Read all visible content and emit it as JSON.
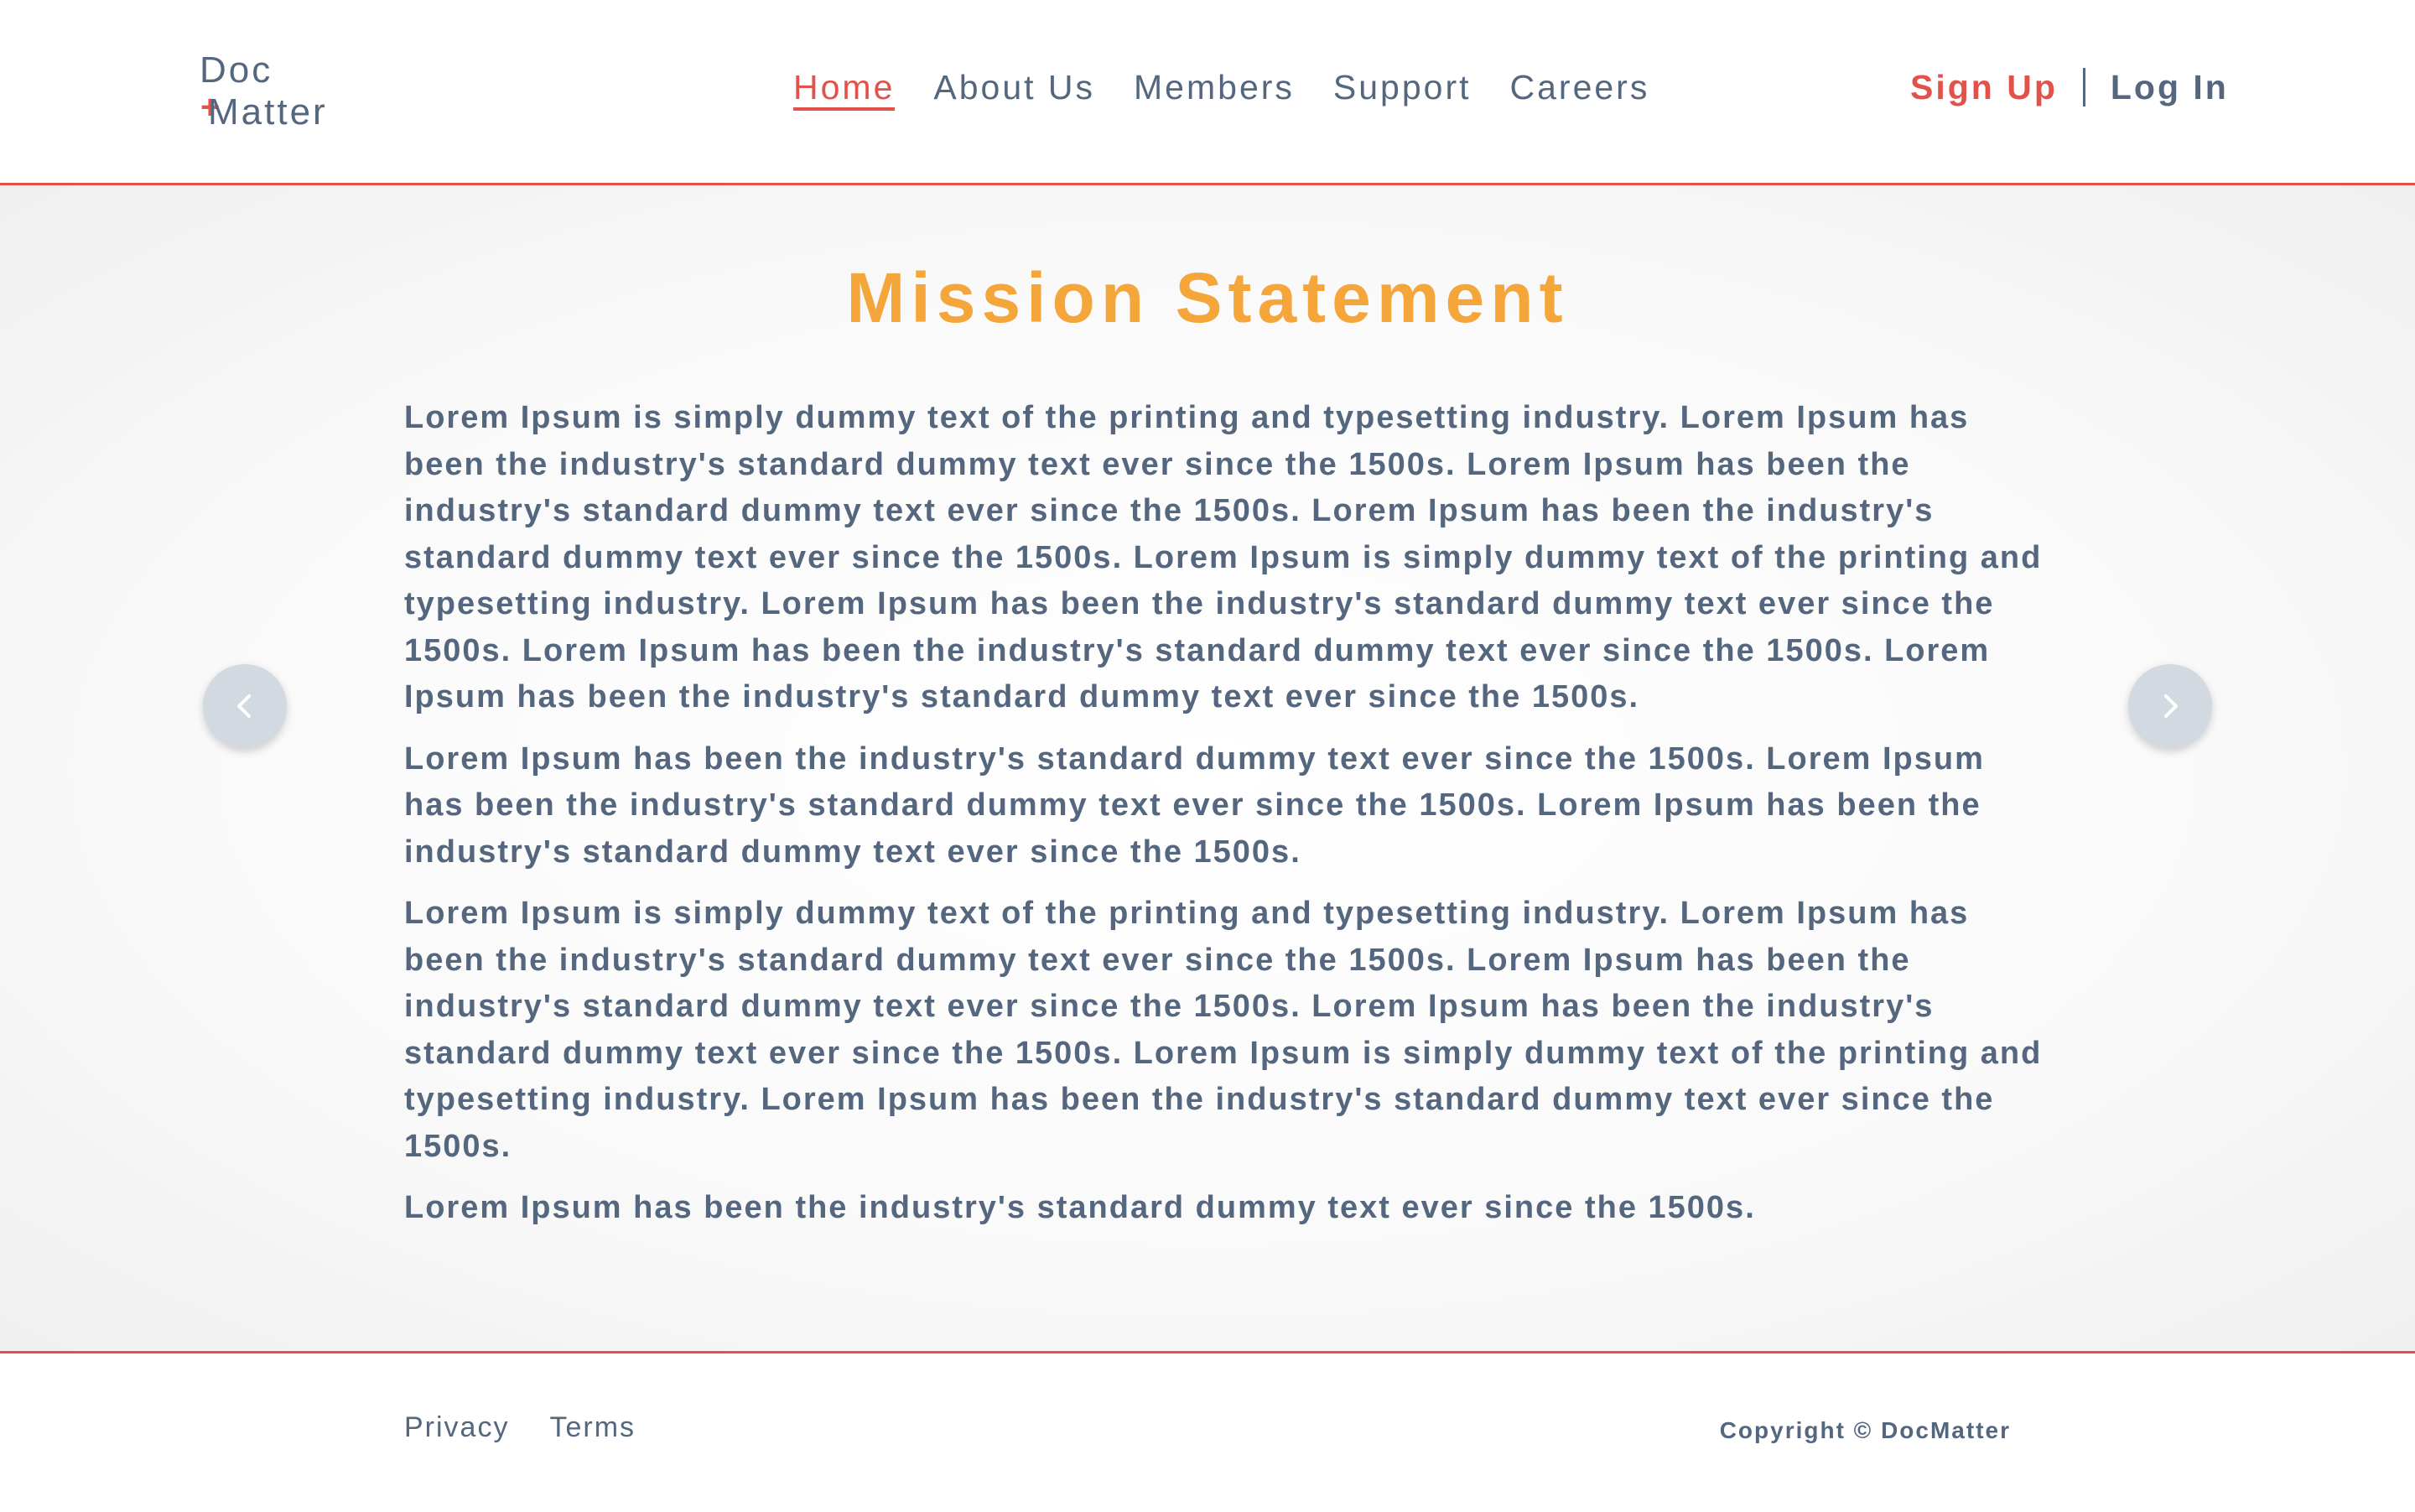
{
  "logo": {
    "line1": "Doc",
    "line2": "Matter",
    "plus": "+"
  },
  "nav": {
    "items": [
      {
        "label": "Home",
        "active": true
      },
      {
        "label": "About Us",
        "active": false
      },
      {
        "label": "Members",
        "active": false
      },
      {
        "label": "Support",
        "active": false
      },
      {
        "label": "Careers",
        "active": false
      }
    ]
  },
  "auth": {
    "signup_label": "Sign Up",
    "login_label": "Log In"
  },
  "main": {
    "title": "Mission Statement",
    "paragraphs": [
      "Lorem Ipsum is simply dummy text of the printing and typesetting industry. Lorem Ipsum has been the industry's standard dummy text ever since the 1500s. Lorem Ipsum has been the industry's standard dummy text ever since the 1500s. Lorem Ipsum has been the industry's standard dummy text ever since the 1500s. Lorem Ipsum is simply dummy text of the printing and typesetting industry. Lorem Ipsum has been the industry's standard dummy text ever since the 1500s. Lorem Ipsum has been the industry's standard dummy text ever since the 1500s. Lorem Ipsum has been the industry's standard dummy text ever since the 1500s.",
      "Lorem Ipsum has been the industry's standard dummy text ever since the 1500s. Lorem Ipsum has been the industry's standard dummy text ever since the 1500s. Lorem Ipsum has been the industry's standard dummy text ever since the 1500s.",
      "Lorem Ipsum is simply dummy text of the printing and typesetting industry. Lorem Ipsum has been the industry's standard dummy text ever since the 1500s. Lorem Ipsum has been the industry's standard dummy text ever since the 1500s. Lorem Ipsum has been the industry's standard dummy text ever since the 1500s. Lorem Ipsum is simply dummy text of the printing and typesetting industry. Lorem Ipsum has been the industry's standard dummy text ever since the 1500s.",
      "Lorem Ipsum has been the industry's standard dummy text ever since the 1500s."
    ]
  },
  "carousel": {
    "prev_icon": "chevron-left-icon",
    "next_icon": "chevron-right-icon"
  },
  "footer": {
    "privacy_label": "Privacy",
    "terms_label": "Terms",
    "copyright": "Copyright © DocMatter"
  },
  "colors": {
    "accent": "#e2514a",
    "title": "#f5a63a",
    "text": "#55677f",
    "carousel_button": "#d3d9e0"
  }
}
